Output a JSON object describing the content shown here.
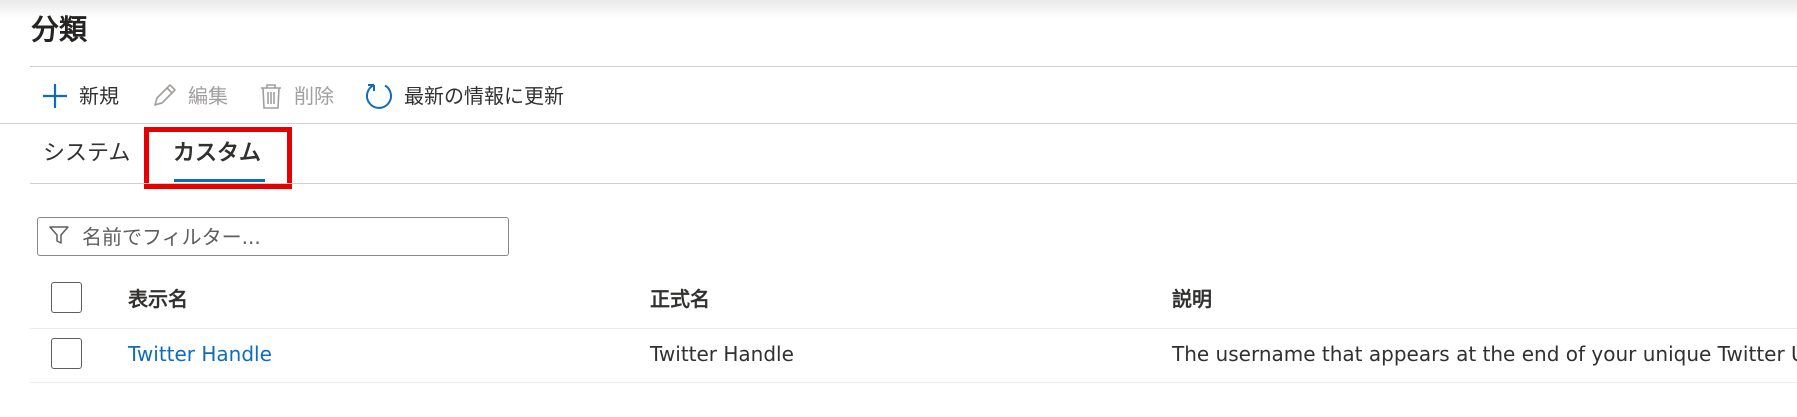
{
  "page": {
    "title": "分類"
  },
  "toolbar": {
    "new_label": "新規",
    "edit_label": "編集",
    "delete_label": "削除",
    "refresh_label": "最新の情報に更新"
  },
  "tabs": [
    {
      "label": "システム",
      "selected": false
    },
    {
      "label": "カスタム",
      "selected": true
    }
  ],
  "filter": {
    "placeholder": "名前でフィルター..."
  },
  "table": {
    "columns": [
      "表示名",
      "正式名",
      "説明"
    ],
    "rows": [
      {
        "display_name": "Twitter Handle",
        "formal_name": "Twitter Handle",
        "description": "The username that appears at the end of your unique Twitter URL."
      }
    ]
  },
  "colors": {
    "accent": "#0f6cbd",
    "highlight_box": "#e60000",
    "disabled_text": "#a19f9d"
  },
  "icons": [
    "add-icon",
    "edit-icon",
    "delete-icon",
    "refresh-icon",
    "filter-icon"
  ]
}
